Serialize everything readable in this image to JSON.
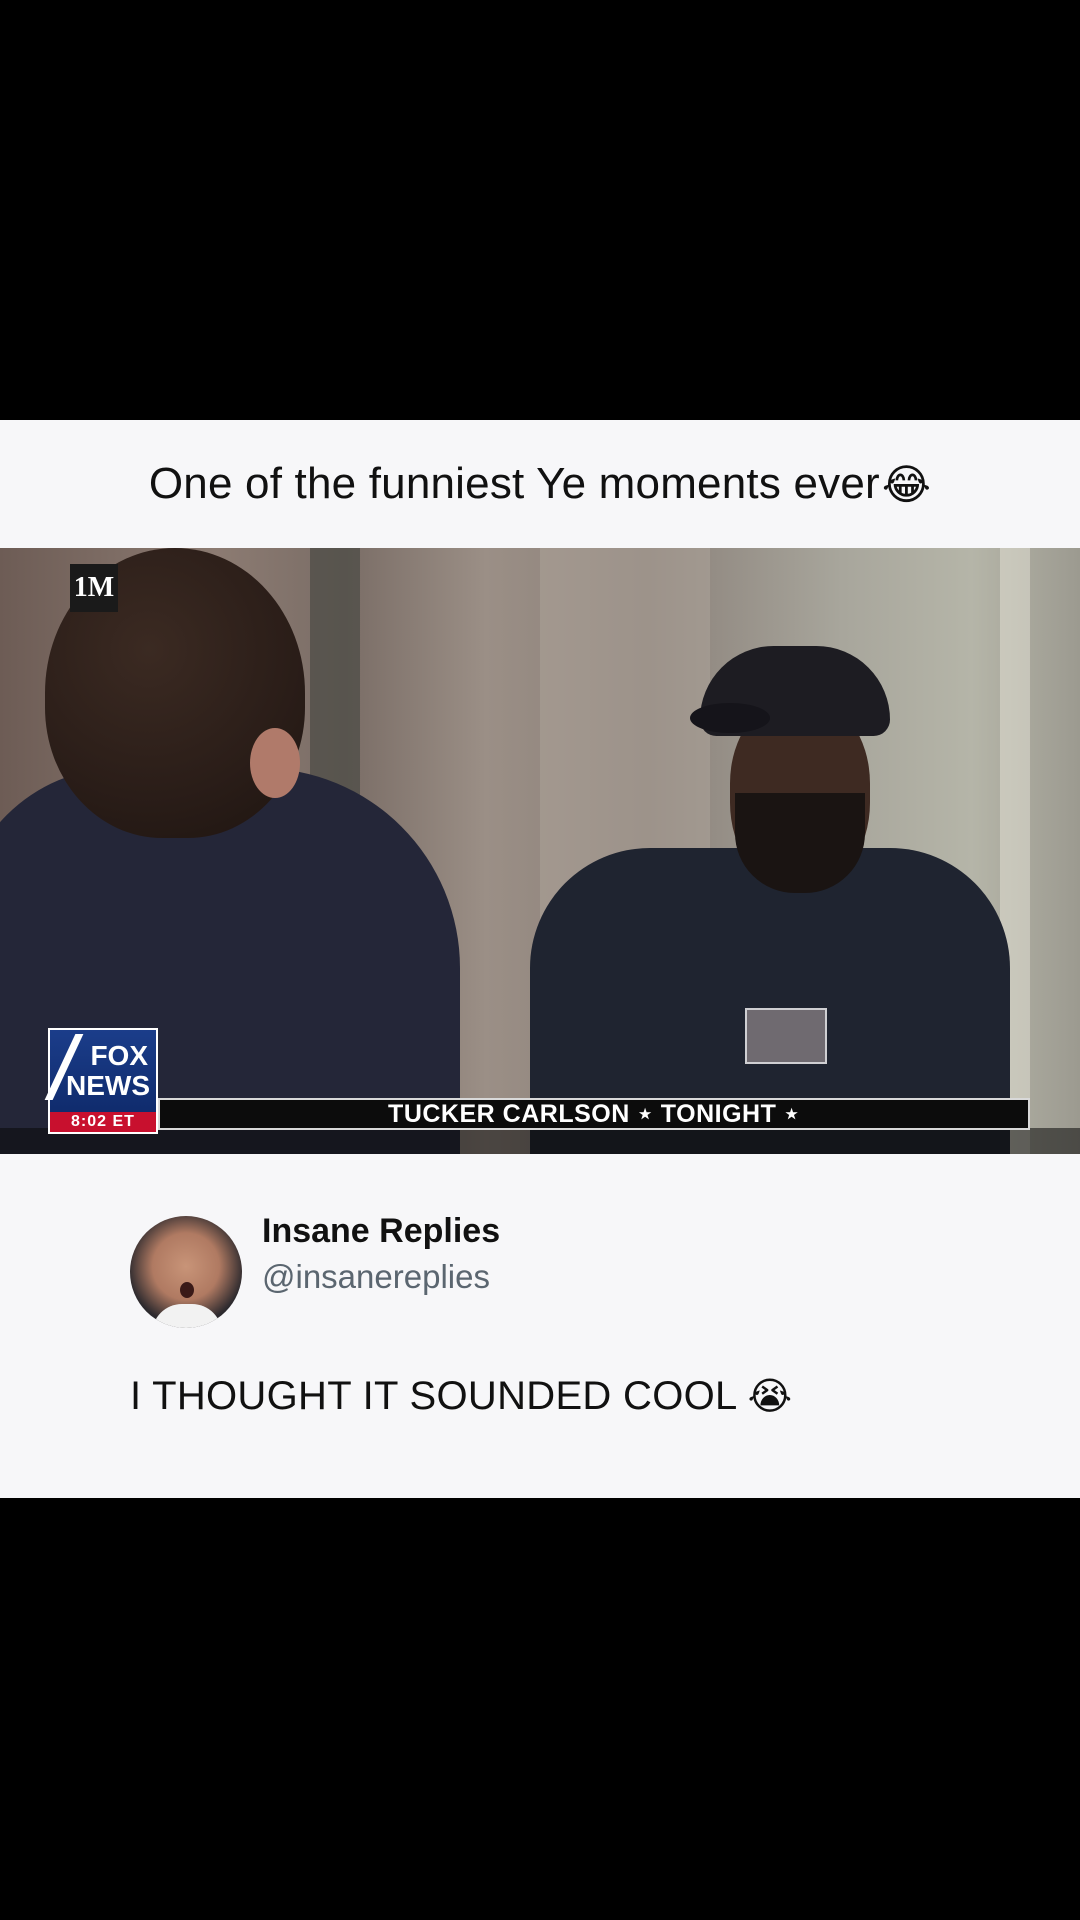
{
  "caption": {
    "text": "One of the funniest Ye moments ever",
    "emoji": "😂"
  },
  "video": {
    "watermark": "1M",
    "network_logo": {
      "line1": "FOX",
      "line2": "NEWS",
      "time": "8:02 ET"
    },
    "lower_third": "TUCKER CARLSON ⋆ TONIGHT ⋆"
  },
  "tweet": {
    "display_name": "Insane Replies",
    "handle": "@insanereplies",
    "text": "I THOUGHT IT SOUNDED COOL",
    "emoji": "😭"
  },
  "colors": {
    "background": "#000000",
    "card": "#f7f7f9",
    "text": "#111111",
    "handle": "#5b6670",
    "fox_blue": "#1b3d8a",
    "fox_red": "#c8102e"
  }
}
